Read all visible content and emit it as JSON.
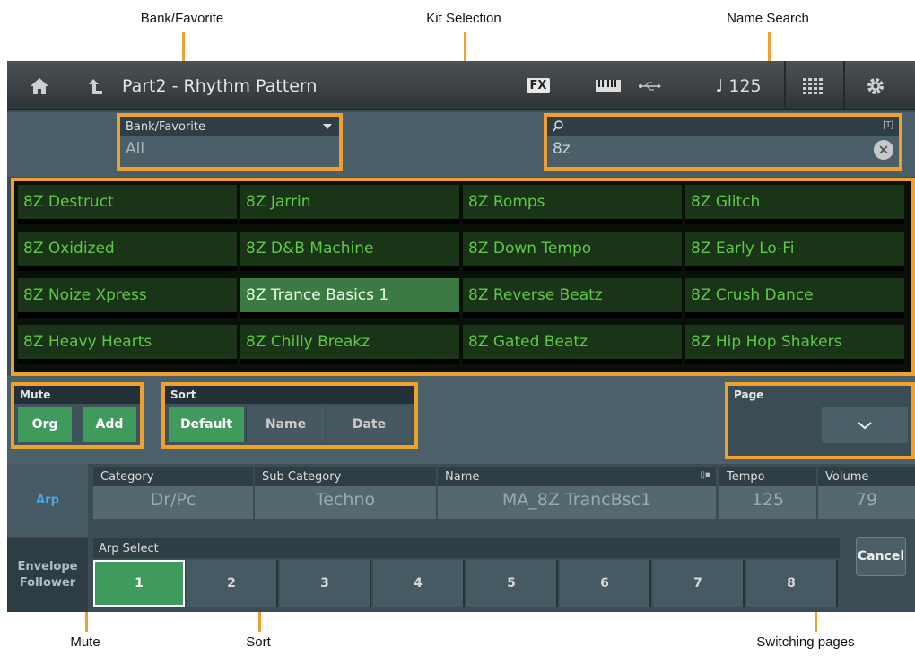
{
  "callouts": {
    "bank_favorite": "Bank/Favorite",
    "kit_selection": "Kit Selection",
    "name_search": "Name Search",
    "mute": "Mute",
    "sort": "Sort",
    "switching_pages": "Switching pages"
  },
  "header": {
    "title": "Part2 - Rhythm Pattern",
    "fx": "FX",
    "tempo": "♩ 125"
  },
  "bank": {
    "label": "Bank/Favorite",
    "value": "All"
  },
  "search": {
    "value": "8z",
    "flag": "[T]"
  },
  "kits": [
    "8Z Destruct",
    "8Z Jarrin",
    "8Z Romps",
    "8Z Glitch",
    "8Z Oxidized",
    "8Z D&B Machine",
    "8Z Down Tempo",
    "8Z Early Lo-Fi",
    "8Z Noize Xpress",
    "8Z Trance Basics 1",
    "8Z Reverse Beatz",
    "8Z Crush Dance",
    "8Z Heavy Hearts",
    "8Z Chilly Breakz",
    "8Z Gated Beatz",
    "8Z Hip Hop Shakers"
  ],
  "selected_kit": "8Z Trance Basics 1",
  "mute": {
    "label": "Mute",
    "buttons": [
      "Org",
      "Add"
    ]
  },
  "sort": {
    "label": "Sort",
    "buttons": [
      "Default",
      "Name",
      "Date"
    ],
    "selected": "Default"
  },
  "page": {
    "label": "Page"
  },
  "side_tabs": {
    "arp": "Arp",
    "envelope": "Envelope Follower"
  },
  "info": {
    "category": {
      "label": "Category",
      "value": "Dr/Pc"
    },
    "sub_category": {
      "label": "Sub Category",
      "value": "Techno"
    },
    "name": {
      "label": "Name",
      "value": "MA_8Z TrancBsc1"
    },
    "tempo": {
      "label": "Tempo",
      "value": "125"
    },
    "volume": {
      "label": "Volume",
      "value": "79"
    }
  },
  "arp_select": {
    "label": "Arp Select",
    "buttons": [
      "1",
      "2",
      "3",
      "4",
      "5",
      "6",
      "7",
      "8"
    ],
    "selected": "1"
  },
  "cancel": "Cancel",
  "colors": {
    "accent": "#f0a030",
    "kit_text": "#5fc947",
    "selected_green": "#3f9a5b",
    "arp_blue": "#4aa9e0"
  }
}
